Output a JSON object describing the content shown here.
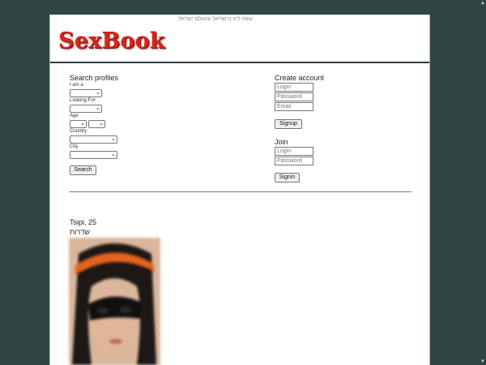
{
  "header": {
    "tagline": "עשה ליוו בישראל ובעולם ישראל",
    "logo": "SexBook"
  },
  "search": {
    "title": "Search profiles",
    "i_am_label": "I am a",
    "looking_for_label": "Looking For",
    "age_label": "Age",
    "country_label": "Country",
    "city_label": "City",
    "button": "Search"
  },
  "create_account": {
    "title": "Create account",
    "login_placeholder": "Login",
    "password_placeholder": "Password",
    "email_placeholder": "Email",
    "button": "Signup"
  },
  "join": {
    "title": "Join",
    "login_placeholder": "Login",
    "password_placeholder": "Password",
    "button": "Signin"
  },
  "profile": {
    "name_age": "Tsipi, 25",
    "city": "שדרות"
  }
}
